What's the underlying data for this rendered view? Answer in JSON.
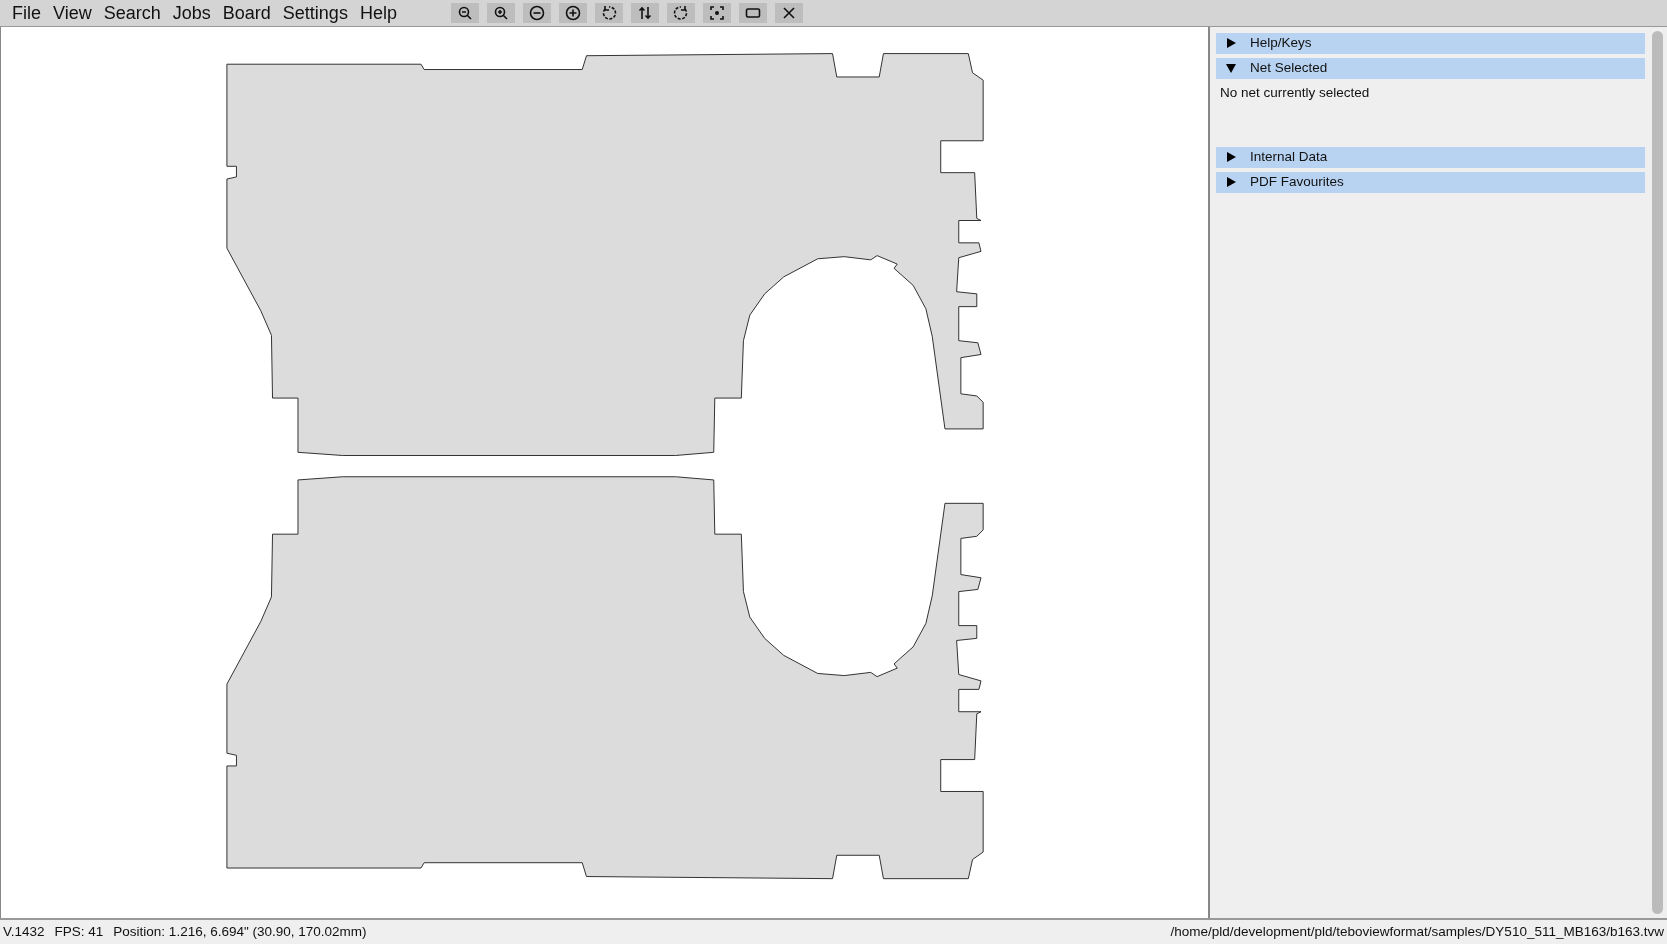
{
  "menu": [
    {
      "label": "File"
    },
    {
      "label": "View"
    },
    {
      "label": "Search"
    },
    {
      "label": "Jobs"
    },
    {
      "label": "Board"
    },
    {
      "label": "Settings"
    },
    {
      "label": "Help"
    }
  ],
  "toolbar": [
    {
      "kind": "zoom-out"
    },
    {
      "kind": "zoom-in"
    },
    {
      "kind": "minus"
    },
    {
      "kind": "plus"
    },
    {
      "kind": "rotate-left"
    },
    {
      "kind": "flip"
    },
    {
      "kind": "rotate-right"
    },
    {
      "kind": "fit"
    },
    {
      "kind": "rect"
    },
    {
      "kind": "close"
    }
  ],
  "sidebar": {
    "panels": [
      {
        "title": "Help/Keys",
        "expanded": false
      },
      {
        "title": "Net Selected",
        "expanded": true,
        "content": "No net currently selected"
      },
      {
        "title": "Internal Data",
        "expanded": false
      },
      {
        "title": "PDF Favourites",
        "expanded": false
      }
    ]
  },
  "status_bar": {
    "version": "V.1432",
    "fps": "FPS: 41",
    "position": "Position: 1.216, 6.694\" (30.90, 170.02mm)",
    "file_path": "/home/pld/development/pld/teboviewformat/samples/DY510_511_MB163/b163.tvw"
  }
}
